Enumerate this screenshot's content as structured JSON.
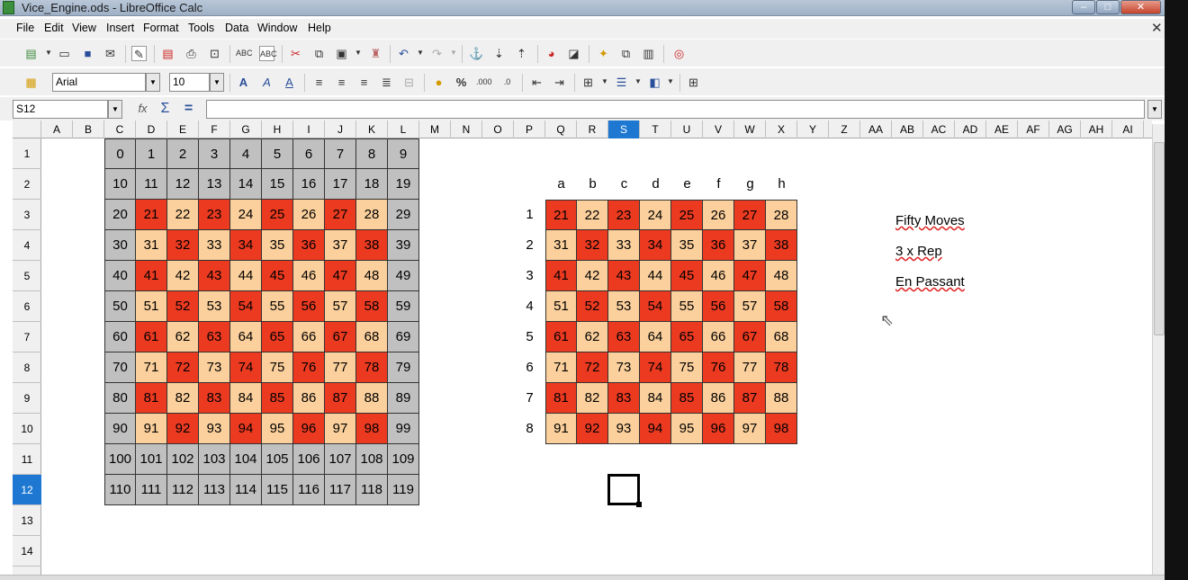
{
  "window": {
    "title": "Vice_Engine.ods - LibreOffice Calc"
  },
  "menu": [
    "File",
    "Edit",
    "View",
    "Insert",
    "Format",
    "Tools",
    "Data",
    "Window",
    "Help"
  ],
  "toolbar": {
    "font_name": "Arial",
    "font_size": "10",
    "icons": [
      "new-icon",
      "open-icon",
      "save-icon",
      "email-icon",
      "edit-mode-icon",
      "export-pdf-icon",
      "print-icon",
      "print-preview-icon",
      "spellcheck-icon",
      "autospell-icon",
      "cut-icon",
      "copy-icon",
      "paste-icon",
      "clone-icon",
      "undo-icon",
      "redo-icon",
      "hyperlink-icon",
      "sort-asc-icon",
      "sort-desc-icon",
      "chart-icon",
      "pivot-icon",
      "navigator-icon",
      "gallery-icon",
      "data-sources-icon",
      "help-icon"
    ]
  },
  "formula": {
    "cell_ref": "S12",
    "value": ""
  },
  "columns": [
    "A",
    "B",
    "C",
    "D",
    "E",
    "F",
    "G",
    "H",
    "I",
    "J",
    "K",
    "L",
    "M",
    "N",
    "O",
    "P",
    "Q",
    "R",
    "S",
    "T",
    "U",
    "V",
    "W",
    "X",
    "Y",
    "Z",
    "AA",
    "AB",
    "AC",
    "AD",
    "AE",
    "AF",
    "AG",
    "AH",
    "AI"
  ],
  "selected_column": "S",
  "rows": [
    "1",
    "2",
    "3",
    "4",
    "5",
    "6",
    "7",
    "8",
    "9",
    "10",
    "11",
    "12",
    "13",
    "14"
  ],
  "selected_row": "12",
  "board120": [
    [
      "0",
      "1",
      "2",
      "3",
      "4",
      "5",
      "6",
      "7",
      "8",
      "9"
    ],
    [
      "10",
      "11",
      "12",
      "13",
      "14",
      "15",
      "16",
      "17",
      "18",
      "19"
    ],
    [
      "20",
      "21",
      "22",
      "23",
      "24",
      "25",
      "26",
      "27",
      "28",
      "29"
    ],
    [
      "30",
      "31",
      "32",
      "33",
      "34",
      "35",
      "36",
      "37",
      "38",
      "39"
    ],
    [
      "40",
      "41",
      "42",
      "43",
      "44",
      "45",
      "46",
      "47",
      "48",
      "49"
    ],
    [
      "50",
      "51",
      "52",
      "53",
      "54",
      "55",
      "56",
      "57",
      "58",
      "59"
    ],
    [
      "60",
      "61",
      "62",
      "63",
      "64",
      "65",
      "66",
      "67",
      "68",
      "69"
    ],
    [
      "70",
      "71",
      "72",
      "73",
      "74",
      "75",
      "76",
      "77",
      "78",
      "79"
    ],
    [
      "80",
      "81",
      "82",
      "83",
      "84",
      "85",
      "86",
      "87",
      "88",
      "89"
    ],
    [
      "90",
      "91",
      "92",
      "93",
      "94",
      "95",
      "96",
      "97",
      "98",
      "99"
    ],
    [
      "100",
      "101",
      "102",
      "103",
      "104",
      "105",
      "106",
      "107",
      "108",
      "109"
    ],
    [
      "110",
      "111",
      "112",
      "113",
      "114",
      "115",
      "116",
      "117",
      "118",
      "119"
    ]
  ],
  "board64": {
    "files": [
      "a",
      "b",
      "c",
      "d",
      "e",
      "f",
      "g",
      "h"
    ],
    "ranks": [
      "1",
      "2",
      "3",
      "4",
      "5",
      "6",
      "7",
      "8"
    ],
    "rows": [
      [
        "21",
        "22",
        "23",
        "24",
        "25",
        "26",
        "27",
        "28"
      ],
      [
        "31",
        "32",
        "33",
        "34",
        "35",
        "36",
        "37",
        "38"
      ],
      [
        "41",
        "42",
        "43",
        "44",
        "45",
        "46",
        "47",
        "48"
      ],
      [
        "51",
        "52",
        "53",
        "54",
        "55",
        "56",
        "57",
        "58"
      ],
      [
        "61",
        "62",
        "63",
        "64",
        "65",
        "66",
        "67",
        "68"
      ],
      [
        "71",
        "72",
        "73",
        "74",
        "75",
        "76",
        "77",
        "78"
      ],
      [
        "81",
        "82",
        "83",
        "84",
        "85",
        "86",
        "87",
        "88"
      ],
      [
        "91",
        "92",
        "93",
        "94",
        "95",
        "96",
        "97",
        "98"
      ]
    ]
  },
  "notes": [
    "Fifty Moves",
    "3 x Rep",
    "En Passant"
  ],
  "colors": {
    "red": "#ec3a21",
    "light": "#fbd09c",
    "grey": "#c0c0c0",
    "selection": "#1e78d2"
  }
}
